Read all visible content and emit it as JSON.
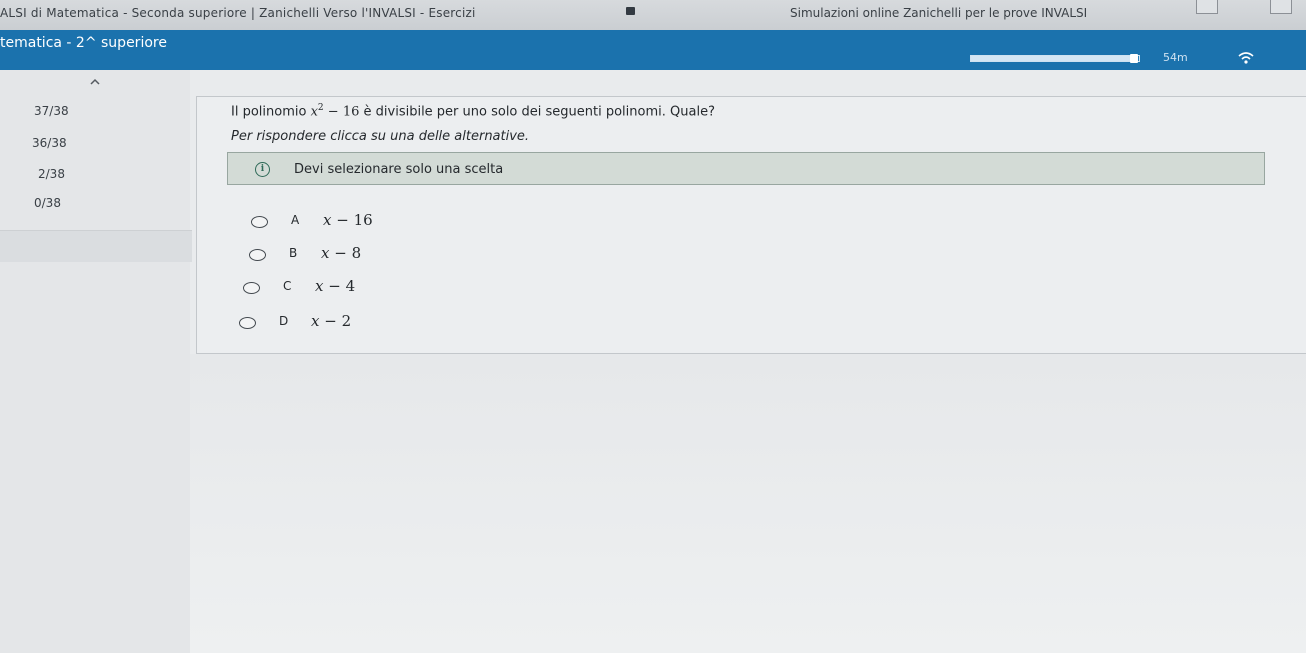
{
  "browser": {
    "tab_title": "ALSI di Matematica - Seconda superiore | Zanichelli Verso l'INVALSI - Esercizi",
    "tab_title_2": "Simulazioni online Zanichelli per le prove INVALSI"
  },
  "header": {
    "title": "tematica - 2^ superiore",
    "progress_fraction": 0.97,
    "timer": "54m"
  },
  "sidebar": {
    "items": [
      {
        "label": "37/38"
      },
      {
        "label": "36/38"
      },
      {
        "label": "2/38"
      },
      {
        "label": "0/38"
      }
    ]
  },
  "question": {
    "text_before": "Il polinomio",
    "polynomial_base": "x",
    "polynomial_exponent": "2",
    "polynomial_rest": "− 16",
    "text_after": "è divisibile per uno solo dei seguenti polinomi. Quale?",
    "instruction": "Per rispondere clicca su una delle alternative.",
    "notice": "Devi selezionare solo una scelta",
    "info_glyph": "i"
  },
  "options": [
    {
      "letter": "A",
      "variable": "x",
      "rest": "− 16"
    },
    {
      "letter": "B",
      "variable": "x",
      "rest": "− 8"
    },
    {
      "letter": "C",
      "variable": "x",
      "rest": "− 4"
    },
    {
      "letter": "D",
      "variable": "x",
      "rest": "− 2"
    }
  ],
  "colors": {
    "header_blue": "#1b72ad",
    "notice_bg": "#d3dbd6",
    "page_bg": "#e9ebed"
  }
}
